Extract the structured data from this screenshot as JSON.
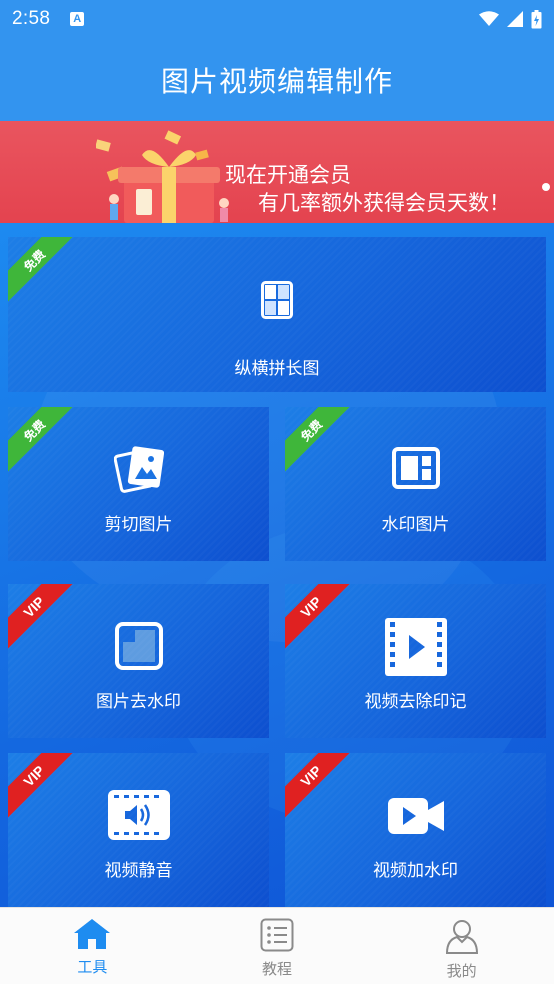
{
  "status_bar": {
    "time": "2:58",
    "indicator": "A",
    "icons": [
      "wifi-icon",
      "signal-icon",
      "battery-icon"
    ]
  },
  "header": {
    "title": "图片视频编辑制作"
  },
  "banner": {
    "line1": "现在开通会员",
    "line2": "有几率额外获得会员天数！"
  },
  "tools": [
    {
      "label": "纵横拼长图",
      "badge": "免费",
      "icon": "collage-grid-icon"
    },
    {
      "label": "剪切图片",
      "badge": "免费",
      "icon": "crop-photos-icon"
    },
    {
      "label": "水印图片",
      "badge": "免费",
      "icon": "watermark-image-icon"
    },
    {
      "label": "图片去水印",
      "badge": "VIP",
      "icon": "remove-watermark-icon"
    },
    {
      "label": "视频去除印记",
      "badge": "VIP",
      "icon": "film-play-icon"
    },
    {
      "label": "视频静音",
      "badge": "VIP",
      "icon": "mute-video-icon"
    },
    {
      "label": "视频加水印",
      "badge": "VIP",
      "icon": "video-camera-icon"
    }
  ],
  "tabbar": {
    "items": [
      {
        "label": "工具",
        "icon": "home-icon",
        "active": true
      },
      {
        "label": "教程",
        "icon": "tutorial-list-icon",
        "active": false
      },
      {
        "label": "我的",
        "icon": "user-icon",
        "active": false
      }
    ]
  },
  "colors": {
    "primary": "#3394ef",
    "banner": "#e4434f",
    "free_ribbon": "#3fb63a",
    "vip_ribbon": "#e02121",
    "tab_active": "#1e8cf0"
  }
}
